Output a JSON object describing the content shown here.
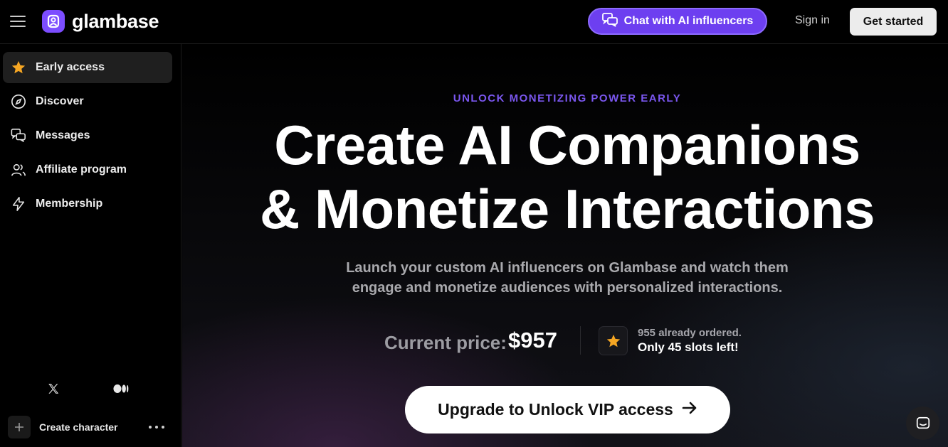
{
  "header": {
    "brand": "glambase",
    "chat_button": "Chat with AI influencers",
    "sign_in": "Sign in",
    "get_started": "Get started"
  },
  "sidebar": {
    "items": [
      {
        "label": "Early access",
        "icon": "star-icon",
        "active": true
      },
      {
        "label": "Discover",
        "icon": "compass-icon",
        "active": false
      },
      {
        "label": "Messages",
        "icon": "messages-icon",
        "active": false
      },
      {
        "label": "Affiliate program",
        "icon": "users-icon",
        "active": false
      },
      {
        "label": "Membership",
        "icon": "lightning-icon",
        "active": false
      }
    ],
    "social": [
      "x-icon",
      "medium-icon"
    ],
    "create_character": "Create character"
  },
  "hero": {
    "eyebrow": "UNLOCK MONETIZING POWER EARLY",
    "headline_line1": "Create AI Companions",
    "headline_line2": "& Monetize Interactions",
    "subhead_line1": "Launch your custom AI influencers on Glambase and watch them",
    "subhead_line2": "engage and monetize audiences with personalized interactions.",
    "price_label": "Current price:",
    "price_value": "$957",
    "ordered_text": "955 already ordered.",
    "slots_text": "Only 45 slots left!",
    "cta_label": "Upgrade to Unlock VIP access"
  },
  "colors": {
    "accent": "#6d3ff0",
    "eyebrow": "#7b57f0",
    "star": "#f5a623"
  }
}
